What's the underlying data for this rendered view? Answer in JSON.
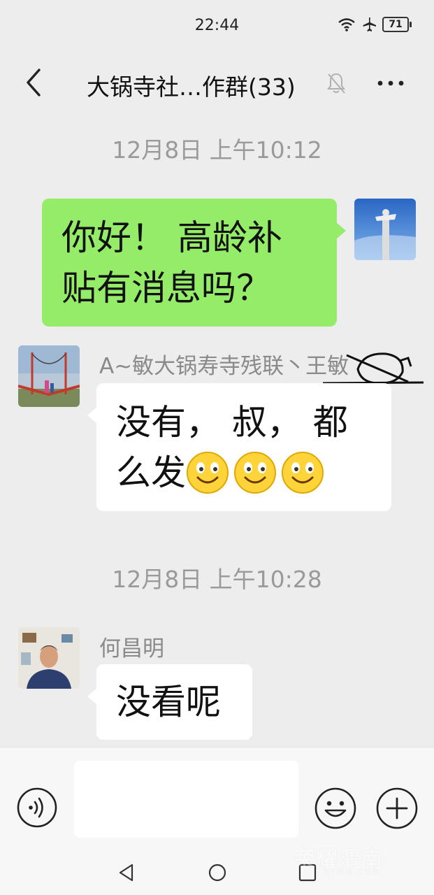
{
  "status_bar": {
    "time": "22:44",
    "battery": "71",
    "icons": [
      "wifi-icon",
      "airplane-icon",
      "battery-icon"
    ]
  },
  "header": {
    "title": "大锅寺社…作群(33)",
    "icons": [
      "back-arrow-icon",
      "mute-bell-icon",
      "more-icon"
    ]
  },
  "chat": {
    "timestamp_1": "12月8日 上午10:12",
    "messages": [
      {
        "side": "right",
        "text_line1": "你好！ 高龄补",
        "text_line2": "贴有消息吗？"
      },
      {
        "side": "left",
        "sender": "A~敏大锅寿寺残联丶王敏",
        "text_line1": "没有， 叔， 都",
        "text_line2": "么发",
        "emojis": [
          "smile-emoji-icon",
          "smile-emoji-icon",
          "smile-emoji-icon"
        ]
      },
      {
        "side": "left",
        "sender": "何昌明",
        "text_line1": "没看呢"
      }
    ],
    "timestamp_2": "12月8日 上午10:28"
  },
  "input_bar": {
    "value": "",
    "icons": [
      "voice-icon",
      "emoji-icon",
      "plus-icon"
    ]
  },
  "watermark": {
    "text": "荣耀渭南",
    "sub": "RYWN.COM"
  },
  "colors": {
    "background": "#ededed",
    "my_bubble": "#95ec69",
    "other_bubble": "#ffffff",
    "timestamp": "#9a9a9a",
    "sender": "#8a8a8a"
  }
}
